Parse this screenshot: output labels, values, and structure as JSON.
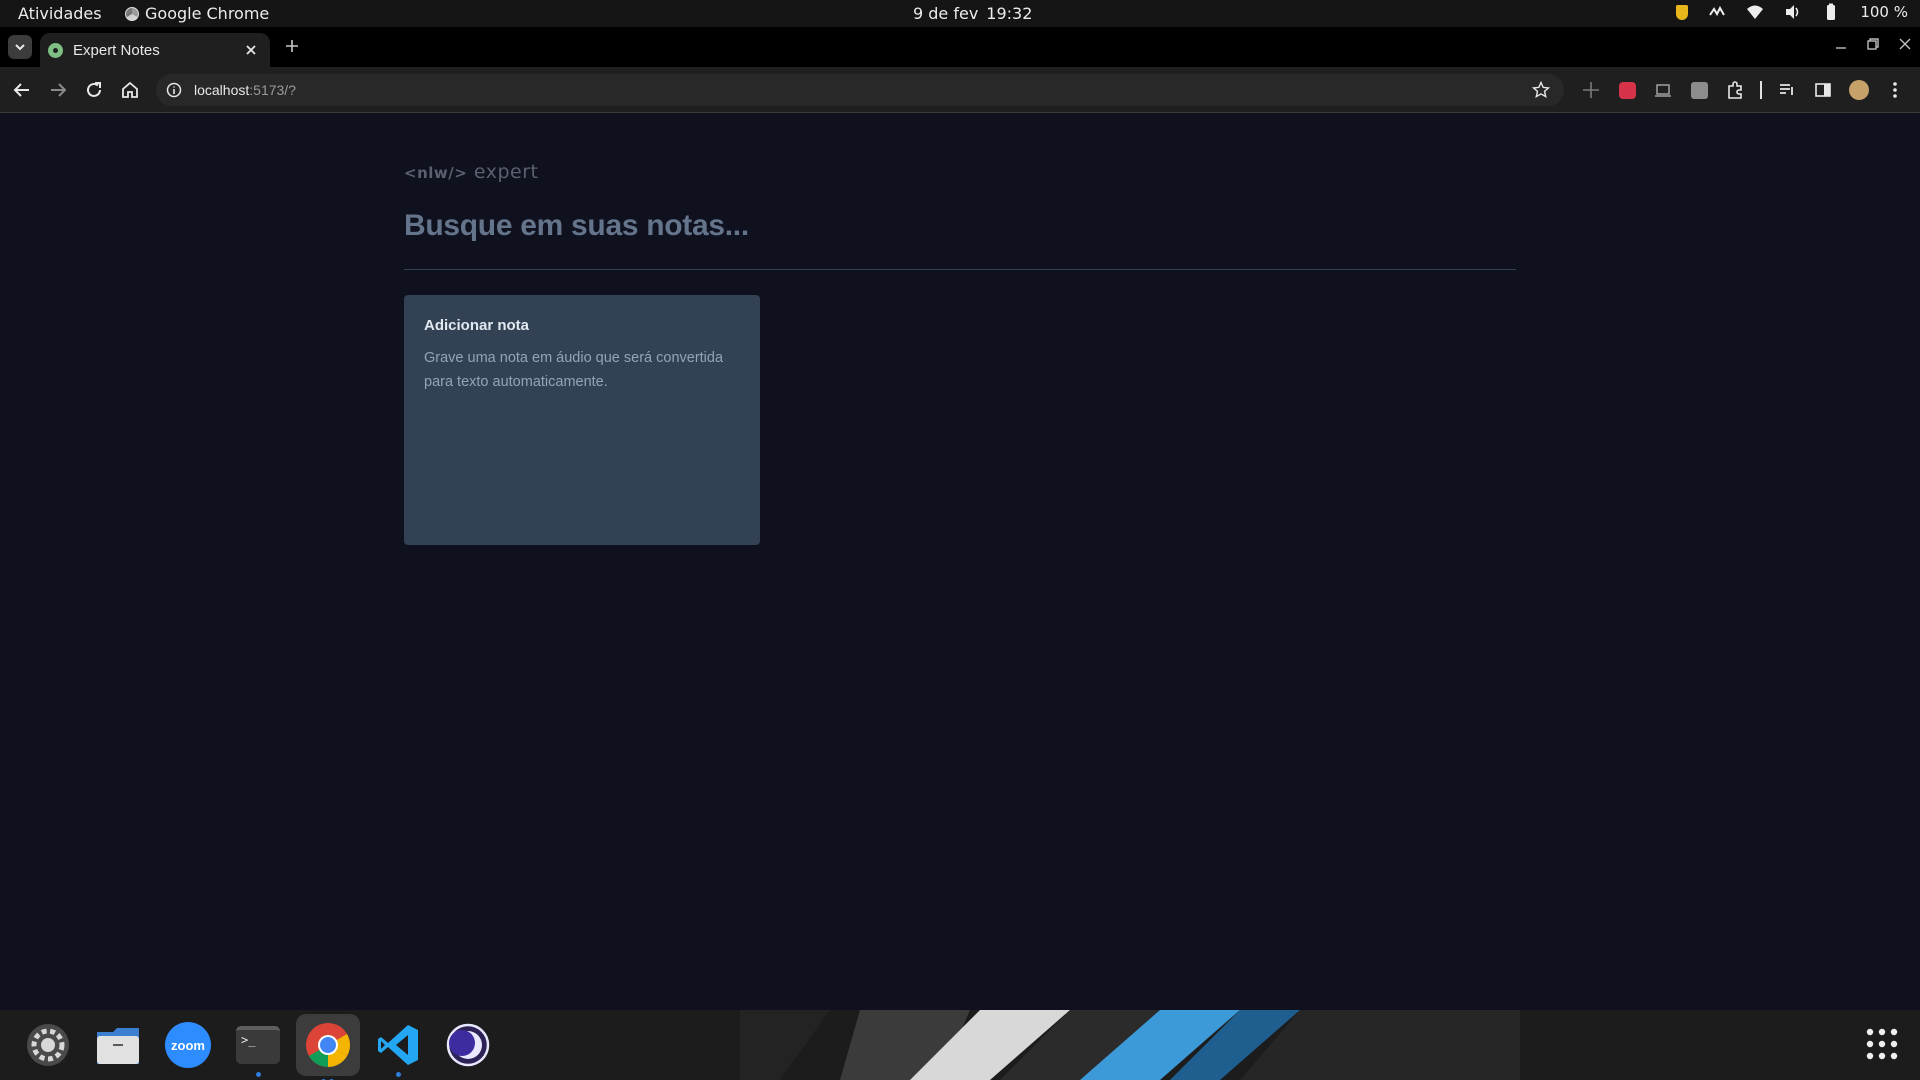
{
  "system_bar": {
    "activities": "Atividades",
    "app_name": "Google Chrome",
    "date": "9 de fev",
    "time": "19:32",
    "battery": "100 %"
  },
  "browser": {
    "tab_title": "Expert Notes",
    "url_host": "localhost",
    "url_rest": ":5173/?",
    "colors": {
      "tab_active": "#1f1f1f",
      "omnibox": "#282828",
      "favicon": "#7fbf84"
    }
  },
  "app": {
    "logo_code": "<nlw/>",
    "logo_word": "expert",
    "search_placeholder": "Busque em suas notas...",
    "add_note_card": {
      "title": "Adicionar nota",
      "description": "Grave uma nota em áudio que será convertida para texto automaticamente."
    },
    "colors": {
      "background": "#0f111f",
      "card": "#334155",
      "divider": "#334155",
      "placeholder": "#64748b",
      "card_text": "#94a3b8"
    }
  },
  "dock": {
    "items": [
      "settings-icon",
      "files-icon",
      "zoom-icon",
      "terminal-icon",
      "chrome-icon",
      "vscode-icon",
      "eclipse-icon"
    ],
    "zoom_label": "zoom",
    "terminal_prompt": ">_"
  }
}
